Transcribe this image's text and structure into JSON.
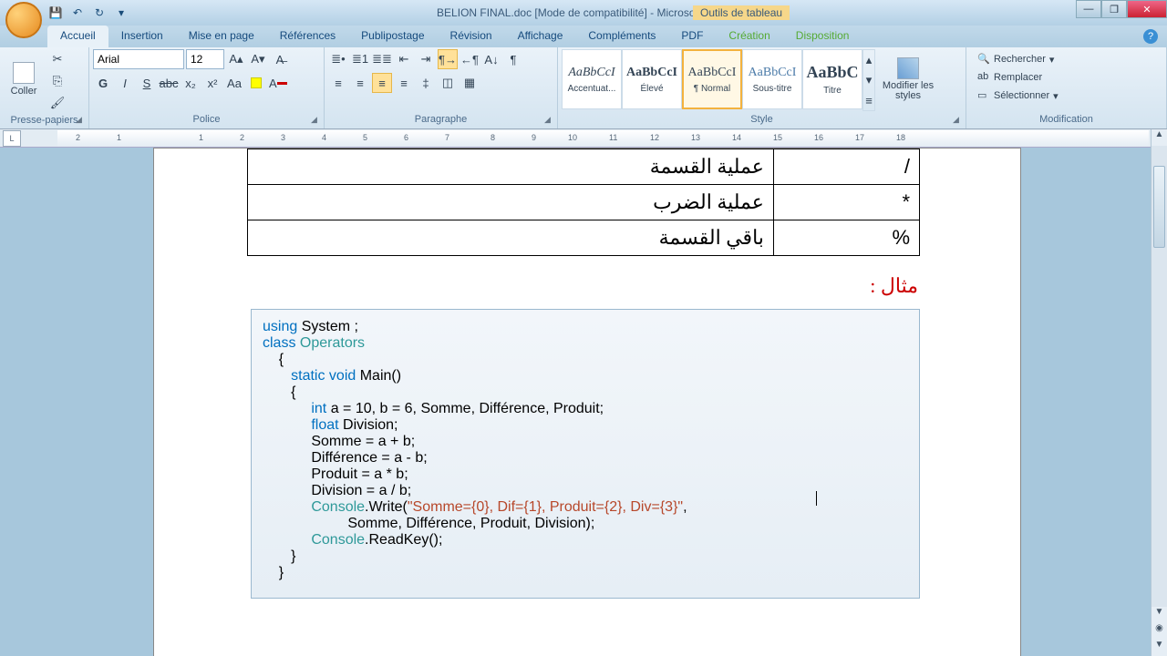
{
  "title": "BELION FINAL.doc [Mode de compatibilité] - Microsoft Word",
  "tabtools_label": "Outils de tableau",
  "tabs": {
    "accueil": "Accueil",
    "insertion": "Insertion",
    "mise_en_page": "Mise en page",
    "references": "Références",
    "publipostage": "Publipostage",
    "revision": "Révision",
    "affichage": "Affichage",
    "complements": "Compléments",
    "pdf": "PDF",
    "creation": "Création",
    "disposition": "Disposition"
  },
  "groups": {
    "presse_papiers": "Presse-papiers",
    "coller": "Coller",
    "police": "Police",
    "paragraphe": "Paragraphe",
    "style": "Style",
    "modification": "Modification",
    "modifier_styles": "Modifier les styles"
  },
  "font": {
    "name": "Arial",
    "size": "12"
  },
  "styles": {
    "s1": {
      "preview": "AaBbCcI",
      "name": "Accentuat..."
    },
    "s2": {
      "preview": "AaBbCcI",
      "name": "Élevé"
    },
    "s3": {
      "preview": "AaBbCcI",
      "name": "¶ Normal"
    },
    "s4": {
      "preview": "AaBbCcI",
      "name": "Sous-titre"
    },
    "s5": {
      "preview": "AaBbC",
      "name": "Titre"
    }
  },
  "editing": {
    "find": "Rechercher",
    "replace": "Remplacer",
    "select": "Sélectionner"
  },
  "ruler_marks": [
    "2",
    "1",
    "1",
    "2",
    "3",
    "4",
    "5",
    "6",
    "7",
    "8",
    "9",
    "10",
    "11",
    "12",
    "13",
    "14",
    "15",
    "16",
    "17",
    "18"
  ],
  "table": {
    "rows": [
      {
        "label": "عملية القسمة",
        "symbol": "/"
      },
      {
        "label": "عملية الضرب",
        "symbol": "*"
      },
      {
        "label": "باقي القسمة",
        "symbol": "%"
      }
    ]
  },
  "example_label": "مثال :",
  "code": {
    "l1a": "using",
    "l1b": " System ;",
    "l2a": "class",
    "l2b": " ",
    "l2c": "Operators",
    "l3": "    {",
    "l4a": "       ",
    "l4b": "static void",
    "l4c": " Main()",
    "l5": "       {",
    "l6a": "            ",
    "l6b": "int",
    "l6c": " a = 10, b = 6, Somme, Différence, Produit;",
    "l7a": "            ",
    "l7b": "float",
    "l7c": " Division;",
    "l8": "            Somme = a + b;",
    "l9": "            Différence = a - b;",
    "l10": "            Produit = a * b;",
    "l11": "            Division = a / b;",
    "l12a": "            ",
    "l12b": "Console",
    "l12c": ".Write(",
    "l12d": "\"Somme={0}, Dif={1}, Produit={2}, Div={3}\"",
    "l12e": ",",
    "l13": "                     Somme, Différence, Produit, Division);",
    "l14a": "            ",
    "l14b": "Console",
    "l14c": ".ReadKey();",
    "l15": "       }",
    "l16": "    }"
  }
}
